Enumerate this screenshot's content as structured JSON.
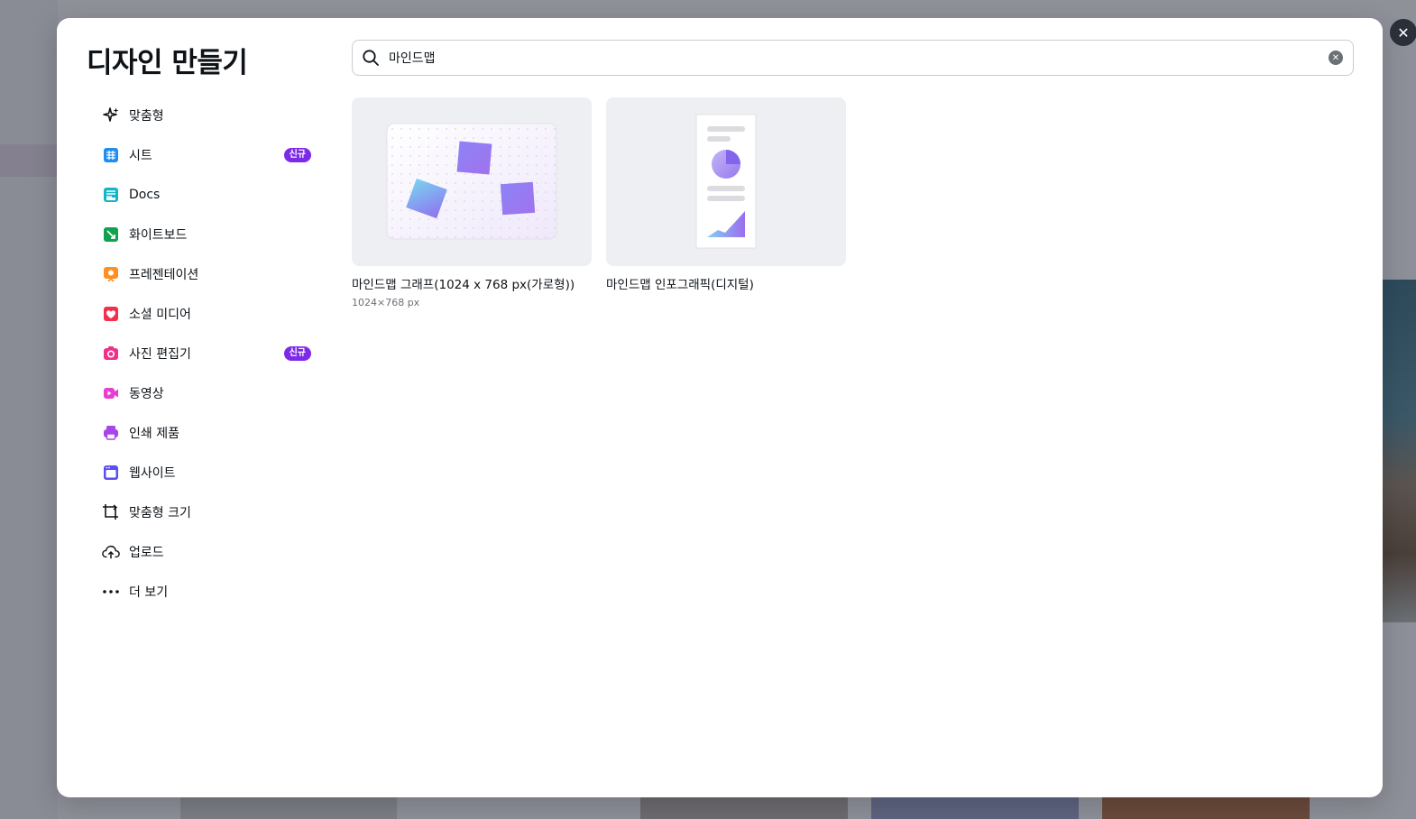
{
  "modal": {
    "title": "디자인 만들기",
    "close_icon": "close-icon"
  },
  "search": {
    "value": "마인드맵",
    "placeholder": "",
    "icon": "search-icon",
    "clear_icon": "clear-icon"
  },
  "sidebar": {
    "items": [
      {
        "label": "맞춤형",
        "icon": "sparkle-icon",
        "badge": ""
      },
      {
        "label": "시트",
        "icon": "sheets-icon",
        "badge": "신규"
      },
      {
        "label": "Docs",
        "icon": "docs-icon",
        "badge": ""
      },
      {
        "label": "화이트보드",
        "icon": "whiteboard-icon",
        "badge": ""
      },
      {
        "label": "프레젠테이션",
        "icon": "presentation-icon",
        "badge": ""
      },
      {
        "label": "소셜 미디어",
        "icon": "heart-icon",
        "badge": ""
      },
      {
        "label": "사진 편집기",
        "icon": "camera-icon",
        "badge": "신규"
      },
      {
        "label": "동영상",
        "icon": "video-icon",
        "badge": ""
      },
      {
        "label": "인쇄 제품",
        "icon": "printer-icon",
        "badge": ""
      },
      {
        "label": "웹사이트",
        "icon": "website-icon",
        "badge": ""
      },
      {
        "label": "맞춤형 크기",
        "icon": "custom-size-icon",
        "badge": ""
      },
      {
        "label": "업로드",
        "icon": "cloud-upload-icon",
        "badge": ""
      },
      {
        "label": "더 보기",
        "icon": "more-icon",
        "badge": ""
      }
    ]
  },
  "results": [
    {
      "title": "마인드맵 그래프(1024 x 768 px(가로형))",
      "subtitle": "1024×768 px"
    },
    {
      "title": "마인드맵 인포그래픽(디지털)",
      "subtitle": ""
    }
  ],
  "colors": {
    "accent_badge": "#7d2ae8",
    "overlay": "#8e9099"
  }
}
